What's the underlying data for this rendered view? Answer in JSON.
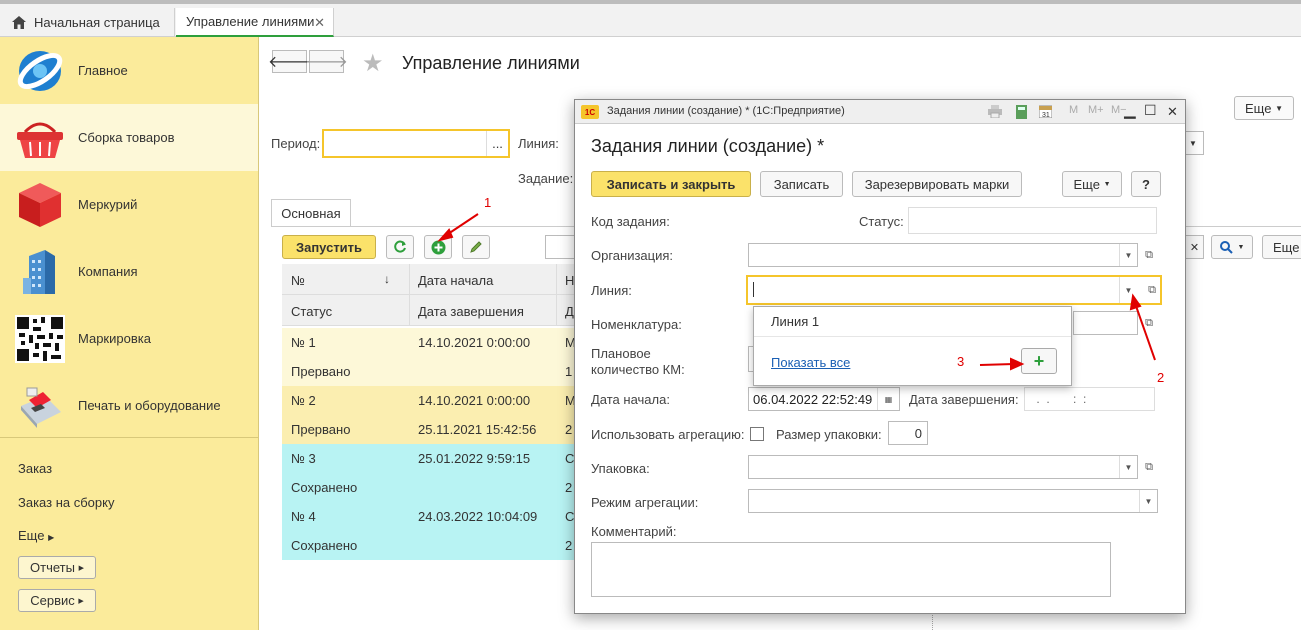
{
  "top_tabs": [
    {
      "label": "Начальная страница"
    },
    {
      "label": "Управление линиями",
      "close": "✕"
    }
  ],
  "sidebar": {
    "sections": [
      {
        "label": "Главное",
        "icon": "globe-icon"
      },
      {
        "label": "Сборка товаров",
        "icon": "shopping-basket-icon",
        "selected": true
      },
      {
        "label": "Меркурий",
        "icon": "cube-icon"
      },
      {
        "label": "Компания",
        "icon": "building-icon"
      },
      {
        "label": "Маркировка",
        "icon": "qr-code-icon"
      },
      {
        "label": "Печать и оборудование",
        "icon": "payment-terminal-icon"
      }
    ],
    "links": [
      "Заказ",
      "Заказ на сборку",
      "Еще"
    ],
    "buttons": [
      "Отчеты",
      "Сервис"
    ]
  },
  "main": {
    "title": "Управление линиями",
    "more": "Еще",
    "period_label": "Период:",
    "period_dots": "...",
    "line_label": "Линия:",
    "task_label": "Задание:",
    "tab": "Основная",
    "start_button": "Запустить",
    "grid": {
      "headers_row1": [
        "№",
        "Дата начала",
        "Н"
      ],
      "headers_row2": [
        "Статус",
        "Дата завершения",
        "Д"
      ],
      "rows": [
        {
          "num": "№ 1",
          "status": "Прервано",
          "start": "14.10.2021 0:00:00",
          "end": "",
          "c3a": "М",
          "c3b": "1",
          "color": "#fdf8d8"
        },
        {
          "num": "№ 2",
          "status": "Прервано",
          "start": "14.10.2021 0:00:00",
          "end": "25.11.2021 15:42:56",
          "c3a": "М",
          "c3b": "2",
          "color": "#fbeeb0"
        },
        {
          "num": "№ 3",
          "status": "Сохранено",
          "start": "25.01.2022 9:59:15",
          "end": "",
          "c3a": "С",
          "c3b": "2",
          "color": "#b8f3f3"
        },
        {
          "num": "№ 4",
          "status": "Сохранено",
          "start": "24.03.2022 10:04:09",
          "end": "",
          "c3a": "С",
          "c3b": "2",
          "color": "#b8f3f3"
        }
      ]
    },
    "right_more": "Еще"
  },
  "modal": {
    "window_title": "Задания линии (создание) * (1С:Предприятие)",
    "logo": "1С",
    "toolbar_icons": [
      "M",
      "M+",
      "M−"
    ],
    "heading": "Задания линии (создание) *",
    "buttons": {
      "save_close": "Записать и закрыть",
      "save": "Записать",
      "reserve": "Зарезервировать марки",
      "more": "Еще",
      "help": "?"
    },
    "fields": {
      "code": "Код задания:",
      "status": "Статус:",
      "org": "Организация:",
      "line": "Линия:",
      "nomenclature": "Номенклатура:",
      "planned_qty": "Плановое количество КМ:",
      "start_date": "Дата начала:",
      "start_date_value": "06.04.2022 22:52:49",
      "end_date": "Дата завершения:",
      "end_date_value": " .  .       :  :",
      "use_aggregation": "Использовать агрегацию:",
      "pack_size": "Размер упаковки:",
      "pack_size_value": "0",
      "package": "Упаковка:",
      "aggregation_mode": "Режим агрегации:",
      "comment": "Комментарий:"
    },
    "dropdown": {
      "item": "Линия 1",
      "show_all": "Показать все",
      "add": "+"
    }
  },
  "annotations": [
    "1",
    "2",
    "3"
  ]
}
